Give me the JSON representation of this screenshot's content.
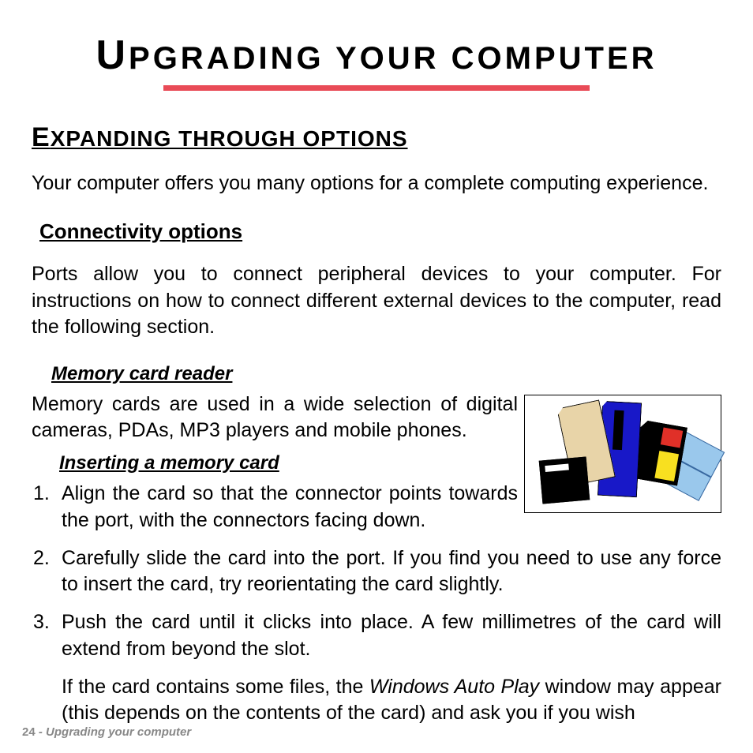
{
  "title_parts": {
    "first_cap": "U",
    "rest": "PGRADING YOUR COMPUTER"
  },
  "section1": {
    "heading_cap": "E",
    "heading_rest": "XPANDING THROUGH OPTIONS",
    "body": "Your computer offers you many options for a complete computing experience."
  },
  "section2": {
    "heading": "Connectivity options",
    "body": "Ports allow you to connect peripheral devices to your computer. For instructions on how to connect different external devices to the computer, read the following section."
  },
  "memory": {
    "heading": "Memory card reader",
    "body": "Memory cards are used in a wide selection of digital cameras, PDAs, MP3 players and mobile phones."
  },
  "insert": {
    "heading": "Inserting a memory card",
    "steps": [
      "Align the card so that the connector points towards the port, with the connectors facing down.",
      "Carefully slide the card into the port. If you find you need to use any force to insert the card, try reorientating the card slightly.",
      "Push the card until it clicks into place. A few millimetres of the card will extend from beyond the slot."
    ],
    "followup_pre": "If the card contains some files, the ",
    "followup_italic": "Windows Auto Play",
    "followup_post": " window may appear (this depends on the contents of the card) and ask you if you wish"
  },
  "footer": {
    "page": "24",
    "sep": " - ",
    "chapter": "Upgrading your computer"
  },
  "image_alt": "memory-cards-illustration"
}
